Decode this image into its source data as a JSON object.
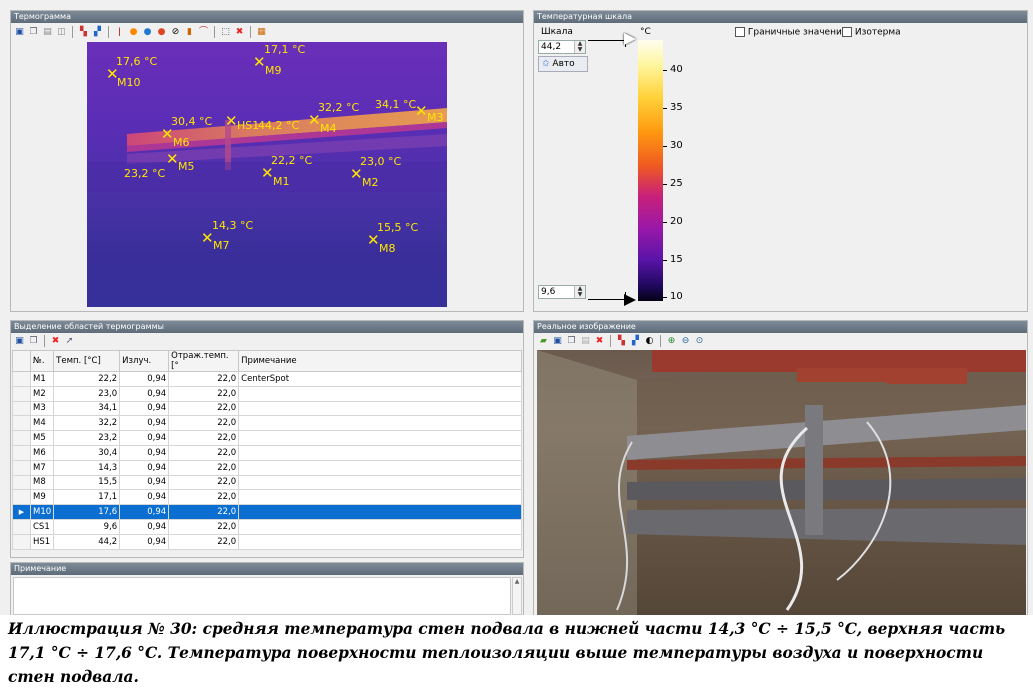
{
  "thermogram": {
    "title": "Термограмма",
    "markers": [
      {
        "name": "M10",
        "temp": "17,6 °C"
      },
      {
        "name": "M9",
        "temp": "17,1 °C"
      },
      {
        "name": "M6",
        "temp": "30,4 °C"
      },
      {
        "name": "HS1",
        "temp": "44,2 °C"
      },
      {
        "name": "M4",
        "temp": "32,2 °C"
      },
      {
        "name": "M3",
        "temp": "34,1 °C"
      },
      {
        "name": "M5",
        "temp": "23,2 °C"
      },
      {
        "name": "M1",
        "temp": "22,2 °C"
      },
      {
        "name": "M2",
        "temp": "23,0 °C"
      },
      {
        "name": "M7",
        "temp": "14,3 °C"
      },
      {
        "name": "M8",
        "temp": "15,5 °C"
      }
    ]
  },
  "scale_panel": {
    "title": "Температурная шкала",
    "scale_label": "Шкала",
    "unit": "°C",
    "max_value": "44,2",
    "min_value": "9,6",
    "auto_label": "Авто",
    "limits_label": "Граничные значения",
    "isotherm_label": "Изотерма",
    "ticks": [
      "40",
      "35",
      "30",
      "25",
      "20",
      "15",
      "10"
    ]
  },
  "regions_panel": {
    "title": "Выделение областей термограммы",
    "columns": [
      "№.",
      "Темп. [°C]",
      "Излуч.",
      "Отраж.темп. [°",
      "Примечание"
    ],
    "rows": [
      {
        "id": "M1",
        "temp": "22,2",
        "emis": "0,94",
        "refl": "22,0",
        "note": "CenterSpot"
      },
      {
        "id": "M2",
        "temp": "23,0",
        "emis": "0,94",
        "refl": "22,0",
        "note": ""
      },
      {
        "id": "M3",
        "temp": "34,1",
        "emis": "0,94",
        "refl": "22,0",
        "note": ""
      },
      {
        "id": "M4",
        "temp": "32,2",
        "emis": "0,94",
        "refl": "22,0",
        "note": ""
      },
      {
        "id": "M5",
        "temp": "23,2",
        "emis": "0,94",
        "refl": "22,0",
        "note": ""
      },
      {
        "id": "M6",
        "temp": "30,4",
        "emis": "0,94",
        "refl": "22,0",
        "note": ""
      },
      {
        "id": "M7",
        "temp": "14,3",
        "emis": "0,94",
        "refl": "22,0",
        "note": ""
      },
      {
        "id": "M8",
        "temp": "15,5",
        "emis": "0,94",
        "refl": "22,0",
        "note": ""
      },
      {
        "id": "M9",
        "temp": "17,1",
        "emis": "0,94",
        "refl": "22,0",
        "note": ""
      },
      {
        "id": "M10",
        "temp": "17,6",
        "emis": "0,94",
        "refl": "22,0",
        "note": ""
      },
      {
        "id": "CS1",
        "temp": "9,6",
        "emis": "0,94",
        "refl": "22,0",
        "note": ""
      },
      {
        "id": "HS1",
        "temp": "44,2",
        "emis": "0,94",
        "refl": "22,0",
        "note": ""
      }
    ],
    "selected_row": "M10"
  },
  "note_panel": {
    "title": "Примечание"
  },
  "photo_panel": {
    "title": "Реальное изображение"
  },
  "caption": "Иллюстрация № 30: средняя температура стен подвала в нижней части 14,3 °C ÷ 15,5 °C, верхняя часть 17,1 °C ÷ 17,6 °C. Температура поверхности теплоизоляции выше температуры воздуха и поверхности стен подвала.",
  "colors": {
    "title_bar": "#6b7886",
    "selection": "#0a6fd0",
    "marker": "#ffe600"
  }
}
